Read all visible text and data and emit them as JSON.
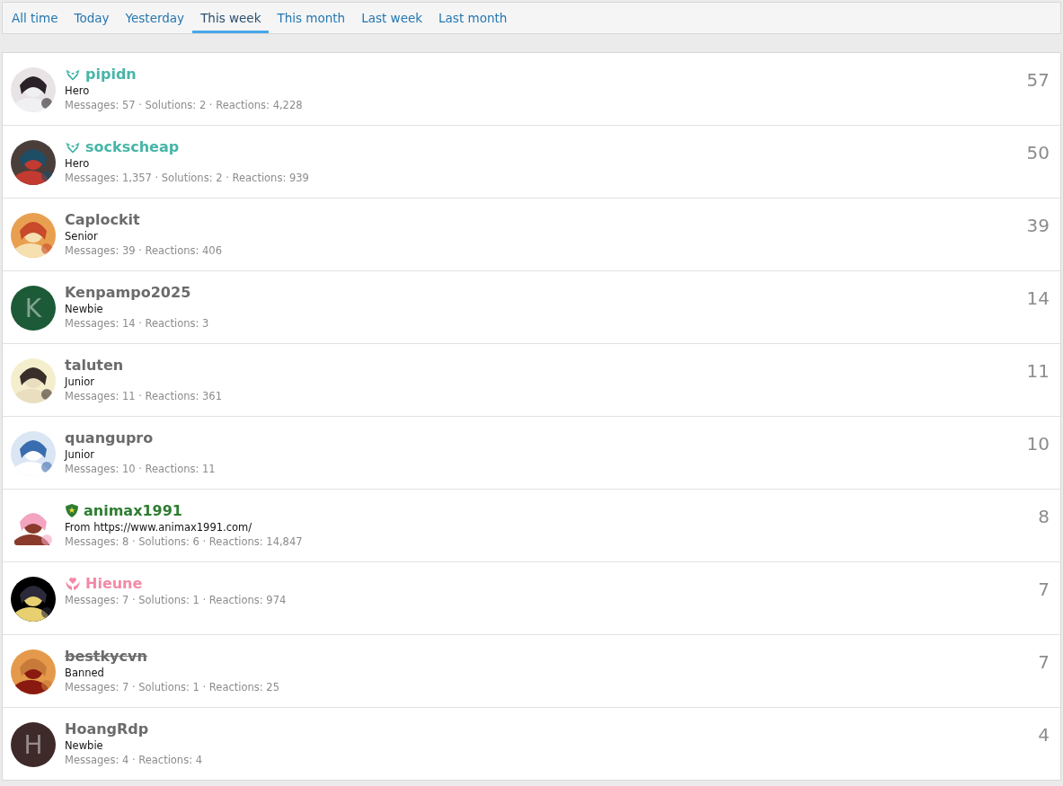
{
  "tabs": [
    {
      "label": "All time",
      "selected": false
    },
    {
      "label": "Today",
      "selected": false
    },
    {
      "label": "Yesterday",
      "selected": false
    },
    {
      "label": "This week",
      "selected": true
    },
    {
      "label": "This month",
      "selected": false
    },
    {
      "label": "Last week",
      "selected": false
    },
    {
      "label": "Last month",
      "selected": false
    }
  ],
  "members": [
    {
      "badge": {
        "kind": "wings"
      },
      "name": "pipidn",
      "color": "#47b5a8",
      "banned": false,
      "title": "Hero",
      "stats": "Messages: 57 · Solutions: 2 · Reactions: 4,228",
      "count": "57"
    },
    {
      "badge": {
        "kind": "wings"
      },
      "name": "sockscheap",
      "color": "#47b5a8",
      "banned": false,
      "title": "Hero",
      "stats": "Messages: 1,357 · Solutions: 2 · Reactions: 939",
      "count": "50"
    },
    {
      "name": "Caplockit",
      "color": "#6b6b6b",
      "banned": false,
      "title": "Senior",
      "stats": "Messages: 39 · Reactions: 406",
      "count": "39"
    },
    {
      "avatar": {
        "kind": "letter",
        "letter": "K",
        "color": "#1c5a38"
      },
      "name": "Kenpampo2025",
      "color": "#6b6b6b",
      "banned": false,
      "title": "Newbie",
      "stats": "Messages: 14 · Reactions: 3",
      "count": "14"
    },
    {
      "name": "taluten",
      "color": "#6b6b6b",
      "banned": false,
      "title": "Junior",
      "stats": "Messages: 11 · Reactions: 361",
      "count": "11"
    },
    {
      "name": "quangupro",
      "color": "#6b6b6b",
      "banned": false,
      "title": "Junior",
      "stats": "Messages: 10 · Reactions: 11",
      "count": "10"
    },
    {
      "badge": {
        "kind": "shield"
      },
      "name": "animax1991",
      "color": "#2e7d32",
      "banned": false,
      "title": "From https://www.animax1991.com/",
      "stats": "Messages: 8 · Solutions: 6 · Reactions: 14,847",
      "count": "8"
    },
    {
      "badge": {
        "kind": "hands"
      },
      "name": "Hieune",
      "color": "#f28aa8",
      "banned": false,
      "stats": "Messages: 7 · Solutions: 1 · Reactions: 974",
      "count": "7"
    },
    {
      "name": "bestkycvn",
      "color": "#6b6b6b",
      "banned": true,
      "title": "Banned",
      "stats": "Messages: 7 · Solutions: 1 · Reactions: 25",
      "count": "7"
    },
    {
      "avatar": {
        "kind": "letter",
        "letter": "H",
        "color": "#3e2a29"
      },
      "name": "HoangRdp",
      "color": "#6b6b6b",
      "banned": false,
      "title": "Newbie",
      "stats": "Messages: 4 · Reactions: 4",
      "count": "4"
    }
  ]
}
